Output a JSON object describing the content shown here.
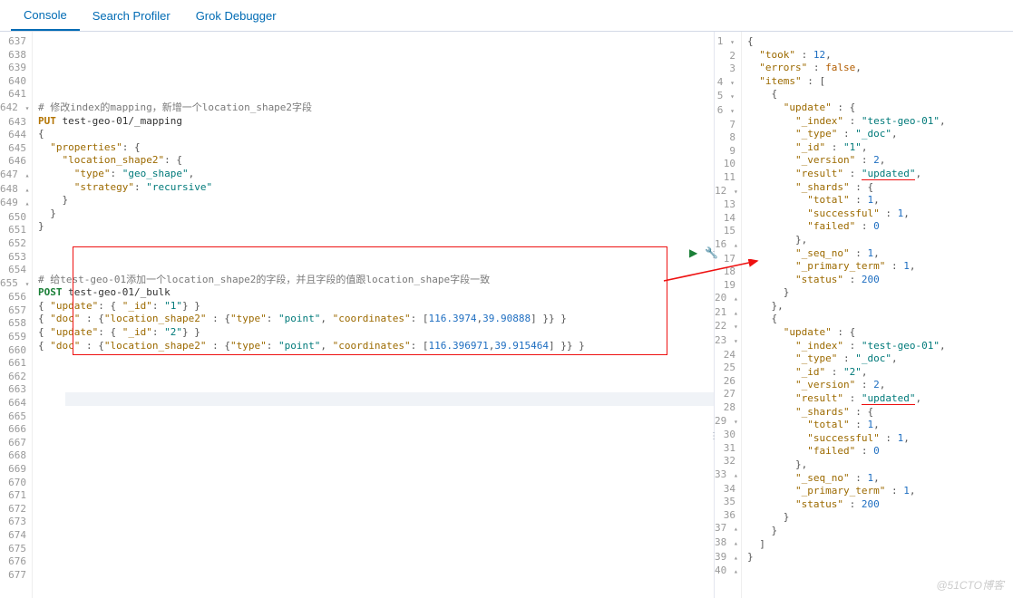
{
  "tabs": {
    "console": "Console",
    "profiler": "Search Profiler",
    "grok": "Grok Debugger"
  },
  "left": {
    "startLine": 637,
    "endLine": 677,
    "comment1": "# 修改index的mapping，新增一个location_shape2字段",
    "put_method": "PUT",
    "put_path": "test-geo-01/_mapping",
    "k_props": "\"properties\"",
    "k_loc2": "\"location_shape2\"",
    "k_type": "\"type\"",
    "v_geo": "\"geo_shape\"",
    "k_strat": "\"strategy\"",
    "v_rec": "\"recursive\"",
    "comment2": "# 给test-geo-01添加一个location_shape2的字段，并且字段的值跟location_shape字段一致",
    "post_method": "POST",
    "post_path": "test-geo-01/_bulk",
    "k_update": "\"update\"",
    "k_id": "\"_id\"",
    "v_1": "\"1\"",
    "v_2": "\"2\"",
    "k_doc": "\"doc\"",
    "k_loc2b": "\"location_shape2\"",
    "v_point": "\"point\"",
    "k_coord": "\"coordinates\"",
    "coord1a": "116.3974",
    "coord1b": "39.90888",
    "coord2a": "116.396971",
    "coord2b": "39.915464"
  },
  "right": {
    "k_took": "\"took\"",
    "v_took": "12",
    "k_err": "\"errors\"",
    "v_false": "false",
    "k_items": "\"items\"",
    "k_update": "\"update\"",
    "k_index": "\"_index\"",
    "v_index": "\"test-geo-01\"",
    "k_type": "\"_type\"",
    "v_type": "\"_doc\"",
    "k_id": "\"_id\"",
    "v_id1": "\"1\"",
    "v_id2": "\"2\"",
    "k_ver": "\"_version\"",
    "v_2": "2",
    "k_res": "\"result\"",
    "v_upd": "\"updated\"",
    "k_shards": "\"_shards\"",
    "k_total": "\"total\"",
    "v_1": "1",
    "k_succ": "\"successful\"",
    "k_fail": "\"failed\"",
    "v_0": "0",
    "k_seq": "\"_seq_no\"",
    "k_pterm": "\"_primary_term\"",
    "k_status": "\"status\"",
    "v_200": "200"
  },
  "watermark": "@51CTO博客"
}
